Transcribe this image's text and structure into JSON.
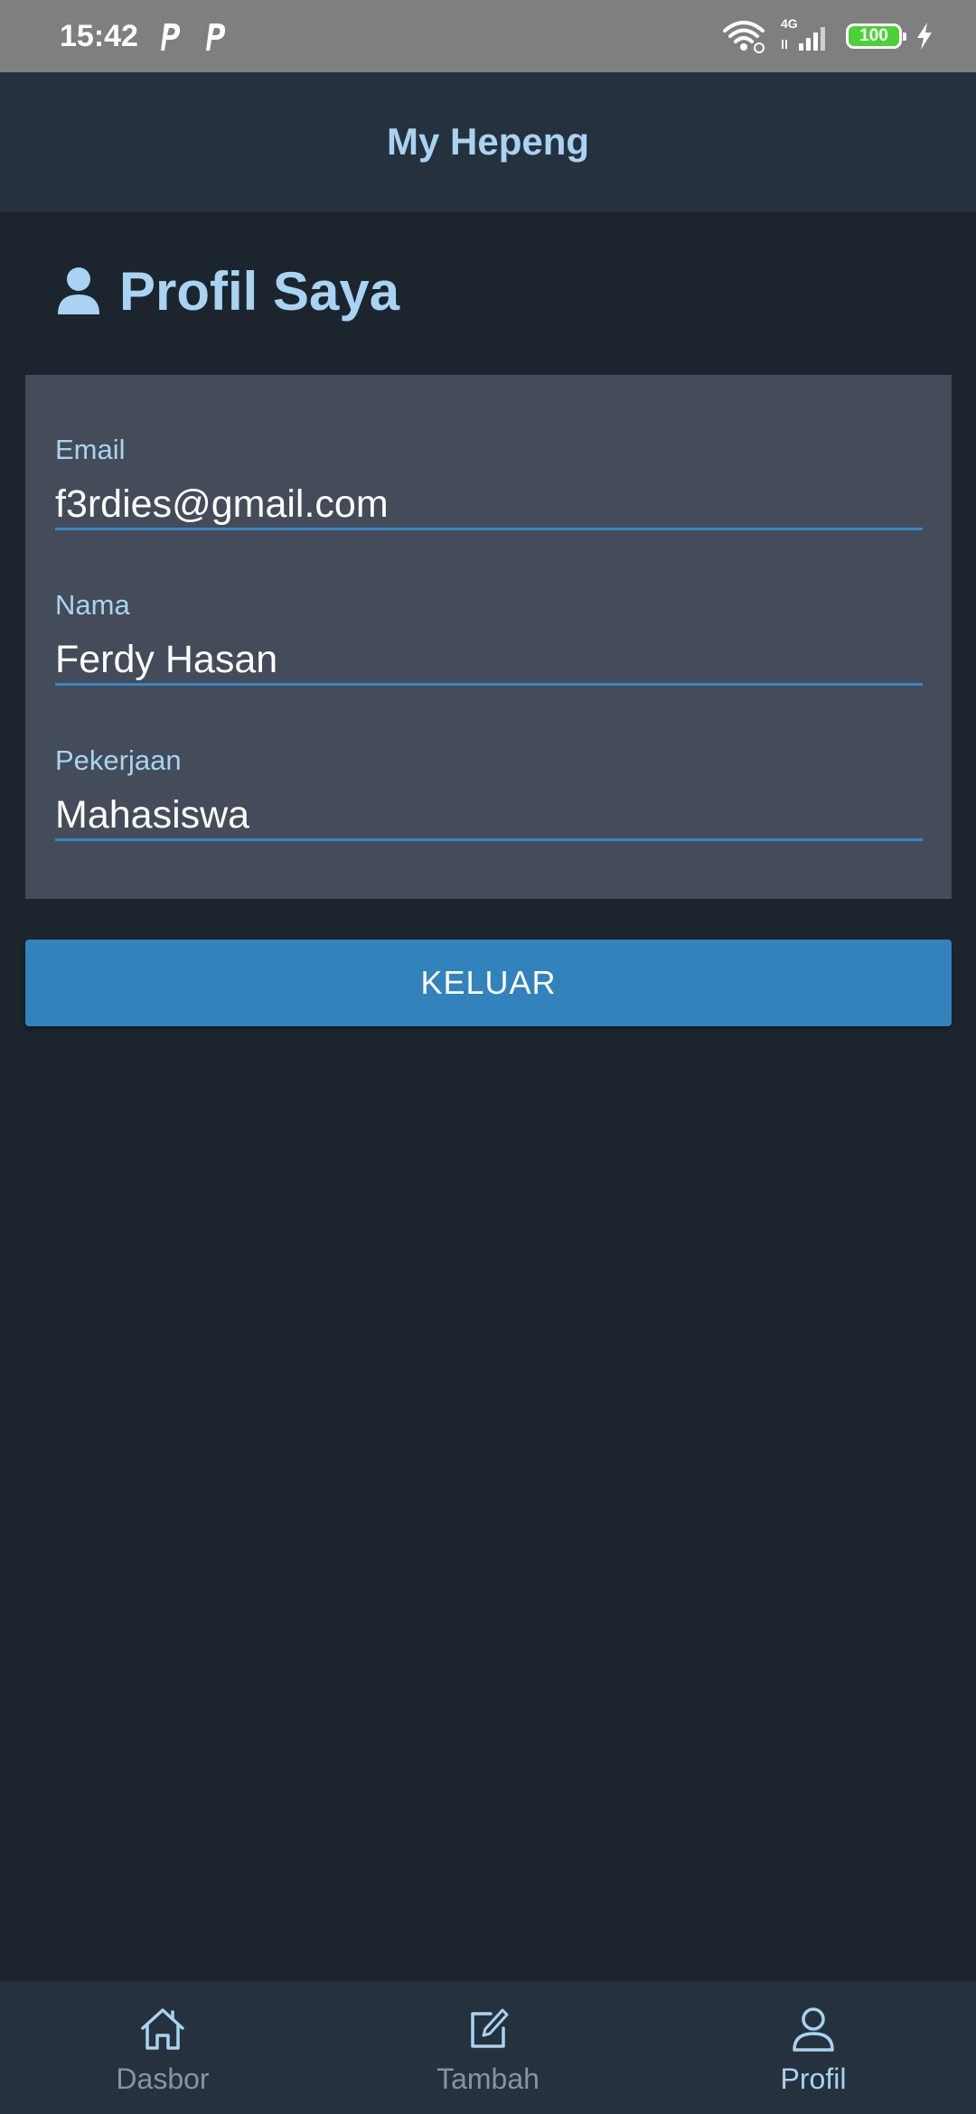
{
  "status_bar": {
    "time": "15:42",
    "network_type": "4G",
    "battery": "100"
  },
  "app": {
    "title": "My Hepeng"
  },
  "page": {
    "title": "Profil Saya",
    "icon": "user-icon"
  },
  "profile": {
    "fields": [
      {
        "label": "Email",
        "value": "f3rdies@gmail.com"
      },
      {
        "label": "Nama",
        "value": "Ferdy Hasan"
      },
      {
        "label": "Pekerjaan",
        "value": "Mahasiswa"
      }
    ]
  },
  "actions": {
    "logout_label": "KELUAR",
    "logout_color": "#3282bb"
  },
  "bottom_nav": {
    "items": [
      {
        "label": "Dasbor",
        "icon": "home-icon",
        "active": false
      },
      {
        "label": "Tambah",
        "icon": "edit-icon",
        "active": false
      },
      {
        "label": "Profil",
        "icon": "user-icon",
        "active": true
      }
    ]
  },
  "colors": {
    "accent": "#a8d3f2",
    "background": "#1c252d",
    "card": "#434c58",
    "underline": "#3a86c4"
  }
}
